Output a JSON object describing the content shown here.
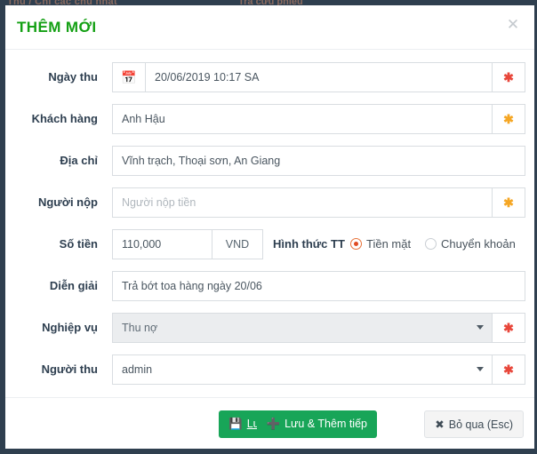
{
  "background": {
    "strip_text_left": "Thu / Chi các chủ nhật",
    "strip_text_right": "Tra cứu phiếu"
  },
  "modal": {
    "title": "THÊM MỚI",
    "close_icon": "close-icon",
    "fields": {
      "date": {
        "label": "Ngày thu",
        "icon": "calendar-icon",
        "value": "20/06/2019 10:17 SA",
        "placeholder": "",
        "required_mark": "✱",
        "required_color": "#e8463a"
      },
      "customer": {
        "label": "Khách hàng",
        "value": "Anh Hậu",
        "placeholder": "",
        "required_mark": "✱",
        "required_color": "#f5a623"
      },
      "address": {
        "label": "Địa chỉ",
        "value": "Vĩnh trạch, Thoại sơn, An Giang",
        "placeholder": ""
      },
      "payer": {
        "label": "Người nộp",
        "value": "",
        "placeholder": "Người nộp tiền",
        "required_mark": "✱",
        "required_color": "#f5a623"
      },
      "amount": {
        "label": "Số tiền",
        "value": "110,000",
        "placeholder": "",
        "currency": "VND"
      },
      "payment_method": {
        "label": "Hình thức TT",
        "options": [
          "Tiền mặt",
          "Chuyển khoản"
        ],
        "selected": "Tiền mặt"
      },
      "description": {
        "label": "Diễn giải",
        "value": "Trả bớt toa hàng ngày 20/06",
        "placeholder": ""
      },
      "operation": {
        "label": "Nghiệp vụ",
        "value": "Thu nợ",
        "disabled": true,
        "required_mark": "✱",
        "required_color": "#e8463a"
      },
      "collector": {
        "label": "Người thu",
        "value": "admin",
        "disabled": false,
        "required_mark": "✱",
        "required_color": "#e8463a"
      }
    },
    "footer": {
      "save_label": "Lưu",
      "save_icon": "save-floppy-icon",
      "save_new_label": "Lưu & Thêm tiếp",
      "save_new_icon": "plus-icon",
      "cancel_label": "Bỏ qua (Esc)",
      "cancel_icon": "close-x-icon"
    }
  }
}
